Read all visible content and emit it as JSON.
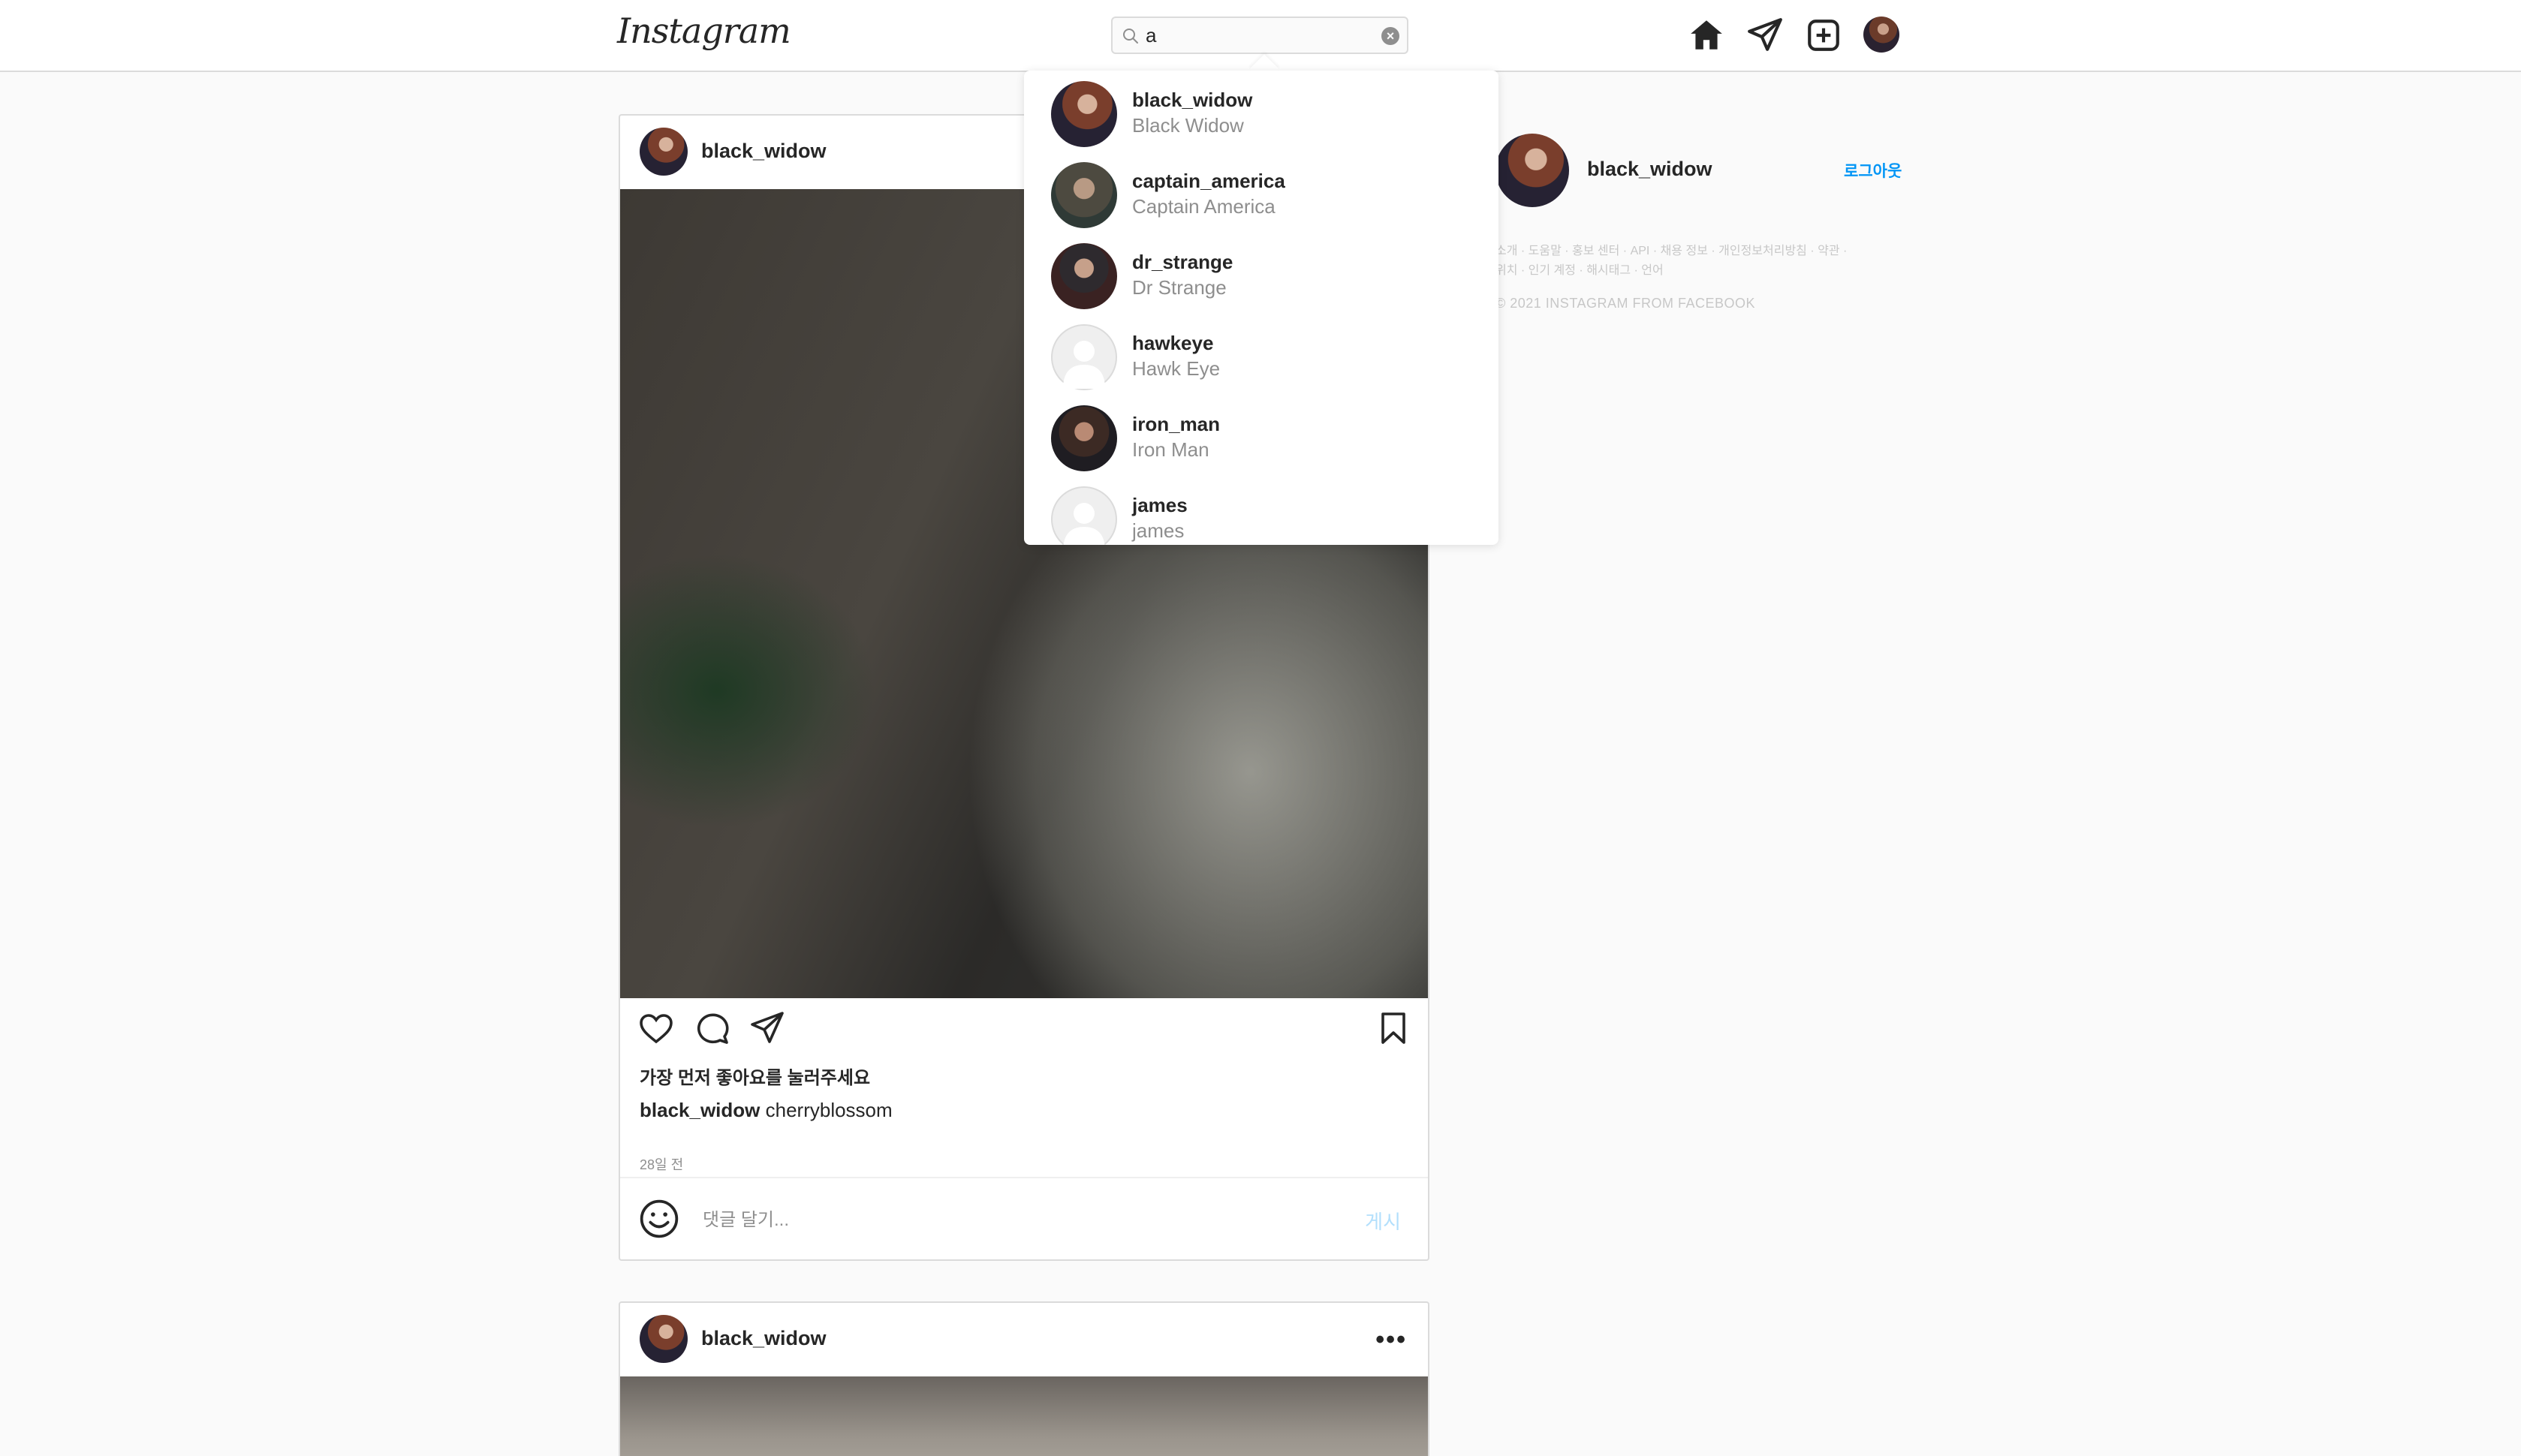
{
  "app": {
    "logo": "Instagram"
  },
  "search": {
    "value": "a",
    "clear_label": "×"
  },
  "nav": {
    "icons": [
      "home-icon",
      "direct-message-icon",
      "new-post-icon",
      "profile-avatar"
    ]
  },
  "search_results": [
    {
      "username": "black_widow",
      "full_name": "Black Widow",
      "avatar": "photo"
    },
    {
      "username": "captain_america",
      "full_name": "Captain America",
      "avatar": "photo"
    },
    {
      "username": "dr_strange",
      "full_name": "Dr Strange",
      "avatar": "photo"
    },
    {
      "username": "hawkeye",
      "full_name": "Hawk Eye",
      "avatar": "default"
    },
    {
      "username": "iron_man",
      "full_name": "Iron Man",
      "avatar": "photo"
    },
    {
      "username": "james",
      "full_name": "james",
      "avatar": "default"
    }
  ],
  "posts": [
    {
      "username": "black_widow",
      "likes_text": "가장 먼저 좋아요를 눌러주세요",
      "caption_user": "black_widow",
      "caption_text": "cherryblossom",
      "time_ago": "28일 전",
      "comment_placeholder": "댓글 달기...",
      "post_button": "게시"
    },
    {
      "username": "black_widow",
      "more": "•••"
    }
  ],
  "sidebar": {
    "username": "black_widow",
    "logout": "로그아웃",
    "footer_links_line1": "소개 · 도움말 · 홍보 센터 · API · 채용 정보 · 개인정보처리방침 · 약관 ·",
    "footer_links_line2": "위치 · 인기 계정 · 해시태그 · 언어",
    "copyright": "© 2021 INSTAGRAM FROM FACEBOOK"
  },
  "colors": {
    "link_blue": "#0095f6",
    "post_button_disabled": "#b2dffc",
    "border": "#dbdbdb",
    "background": "#fafafa"
  }
}
